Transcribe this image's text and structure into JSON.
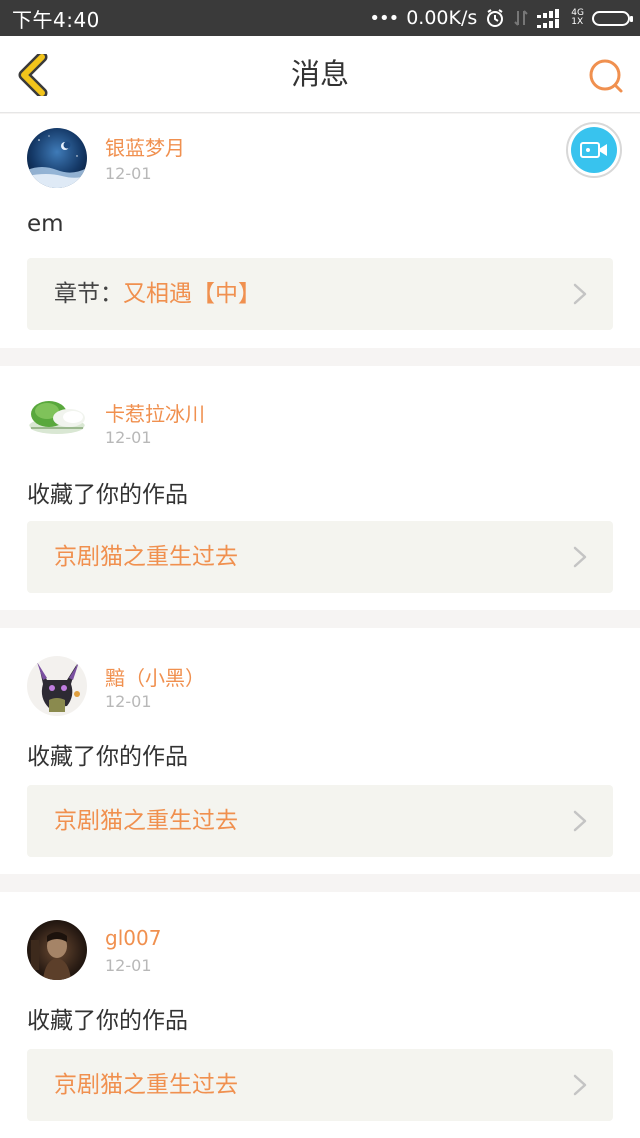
{
  "status_bar": {
    "time": "下午4:40",
    "network_speed": "0.00K/s",
    "network_type_top": "4G",
    "network_type_bottom": "1X"
  },
  "header": {
    "title": "消息",
    "back_icon": "chevron-left-icon",
    "search_icon": "search-icon"
  },
  "colors": {
    "accent": "#f0904f",
    "back_yellow": "#f2c41b",
    "video_blue": "#38c3ee",
    "link_bg": "#f4f4ef"
  },
  "messages": [
    {
      "username": "银蓝梦月",
      "date": "12-01",
      "text": "em",
      "link_prefix": "章节：",
      "link_text": "又相遇【中】",
      "avatar": "night-sky-avatar"
    },
    {
      "username": "卡惹拉冰川",
      "date": "12-01",
      "text": "收藏了你的作品",
      "link_prefix": "",
      "link_text": "京剧猫之重生过去",
      "avatar": "cabbage-avatar"
    },
    {
      "username": "黯（小黑）",
      "date": "12-01",
      "text": "收藏了你的作品",
      "link_prefix": "",
      "link_text": "京剧猫之重生过去",
      "avatar": "black-cat-avatar"
    },
    {
      "username": "gl007",
      "date": "12-01",
      "text": "收藏了你的作品",
      "link_prefix": "",
      "link_text": "京剧猫之重生过去",
      "avatar": "dark-portrait-avatar"
    }
  ]
}
